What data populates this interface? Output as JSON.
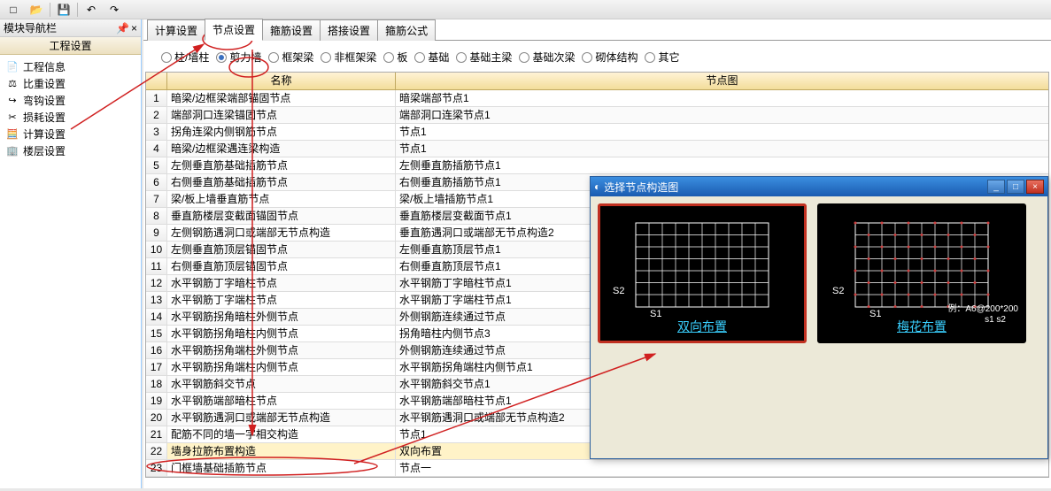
{
  "toolbar": {
    "new": "□",
    "open": "📂",
    "save": "💾",
    "undo": "↶",
    "redo": "↷"
  },
  "leftPanel": {
    "title": "模块导航栏",
    "section": "工程设置",
    "items": [
      {
        "icon": "📄",
        "label": "工程信息"
      },
      {
        "icon": "⚖",
        "label": "比重设置"
      },
      {
        "icon": "↪",
        "label": "弯钩设置"
      },
      {
        "icon": "✂",
        "label": "损耗设置"
      },
      {
        "icon": "🧮",
        "label": "计算设置"
      },
      {
        "icon": "🏢",
        "label": "楼层设置"
      }
    ]
  },
  "tabs": [
    {
      "label": "计算设置"
    },
    {
      "label": "节点设置",
      "active": true
    },
    {
      "label": "箍筋设置"
    },
    {
      "label": "搭接设置"
    },
    {
      "label": "箍筋公式"
    }
  ],
  "radios": [
    {
      "label": "柱/墙柱"
    },
    {
      "label": "剪力墙",
      "checked": true
    },
    {
      "label": "框架梁"
    },
    {
      "label": "非框架梁"
    },
    {
      "label": "板"
    },
    {
      "label": "基础"
    },
    {
      "label": "基础主梁"
    },
    {
      "label": "基础次梁"
    },
    {
      "label": "砌体结构"
    },
    {
      "label": "其它"
    }
  ],
  "table": {
    "head": {
      "name": "名称",
      "node": "节点图"
    },
    "rows": [
      {
        "n": "1",
        "name": "暗梁/边框梁端部锚固节点",
        "node": "暗梁端部节点1"
      },
      {
        "n": "2",
        "name": "端部洞口连梁锚固节点",
        "node": "端部洞口连梁节点1"
      },
      {
        "n": "3",
        "name": "拐角连梁内侧钢筋节点",
        "node": "节点1"
      },
      {
        "n": "4",
        "name": "暗梁/边框梁遇连梁构造",
        "node": "节点1"
      },
      {
        "n": "5",
        "name": "左侧垂直筋基础插筋节点",
        "node": "左侧垂直筋插筋节点1"
      },
      {
        "n": "6",
        "name": "右侧垂直筋基础插筋节点",
        "node": "右侧垂直筋插筋节点1"
      },
      {
        "n": "7",
        "name": "梁/板上墙垂直筋节点",
        "node": "梁/板上墙插筋节点1"
      },
      {
        "n": "8",
        "name": "垂直筋楼层变截面锚固节点",
        "node": "垂直筋楼层变截面节点1"
      },
      {
        "n": "9",
        "name": "左侧钢筋遇洞口或端部无节点构造",
        "node": "垂直筋遇洞口或端部无节点构造2"
      },
      {
        "n": "10",
        "name": "左侧垂直筋顶层锚固节点",
        "node": "左侧垂直筋顶层节点1"
      },
      {
        "n": "11",
        "name": "右侧垂直筋顶层锚固节点",
        "node": "右侧垂直筋顶层节点1"
      },
      {
        "n": "12",
        "name": "水平钢筋丁字暗柱节点",
        "node": "水平钢筋丁字暗柱节点1"
      },
      {
        "n": "13",
        "name": "水平钢筋丁字端柱节点",
        "node": "水平钢筋丁字端柱节点1"
      },
      {
        "n": "14",
        "name": "水平钢筋拐角暗柱外侧节点",
        "node": "外侧钢筋连续通过节点"
      },
      {
        "n": "15",
        "name": "水平钢筋拐角暗柱内侧节点",
        "node": "拐角暗柱内侧节点3"
      },
      {
        "n": "16",
        "name": "水平钢筋拐角端柱外侧节点",
        "node": "外侧钢筋连续通过节点"
      },
      {
        "n": "17",
        "name": "水平钢筋拐角端柱内侧节点",
        "node": "水平钢筋拐角端柱内侧节点1"
      },
      {
        "n": "18",
        "name": "水平钢筋斜交节点",
        "node": "水平钢筋斜交节点1"
      },
      {
        "n": "19",
        "name": "水平钢筋端部暗柱节点",
        "node": "水平钢筋端部暗柱节点1"
      },
      {
        "n": "20",
        "name": "水平钢筋遇洞口或端部无节点构造",
        "node": "水平钢筋遇洞口或端部无节点构造2"
      },
      {
        "n": "21",
        "name": "配筋不同的墙一字相交构造",
        "node": "节点1"
      },
      {
        "n": "22",
        "name": "墙身拉筋布置构造",
        "node": "双向布置",
        "sel": true
      },
      {
        "n": "23",
        "name": "门框墙基础插筋节点",
        "node": "节点一"
      }
    ]
  },
  "dialog": {
    "title": "选择节点构造图",
    "min": "_",
    "max": "□",
    "close": "×",
    "thumbs": [
      {
        "label": "双向布置",
        "s1": "S1",
        "s2": "S2",
        "selected": true
      },
      {
        "label": "梅花布置",
        "s1": "S1",
        "s2": "S2",
        "example": "例：A6@200*200",
        "sub": "s1    s2"
      }
    ]
  }
}
